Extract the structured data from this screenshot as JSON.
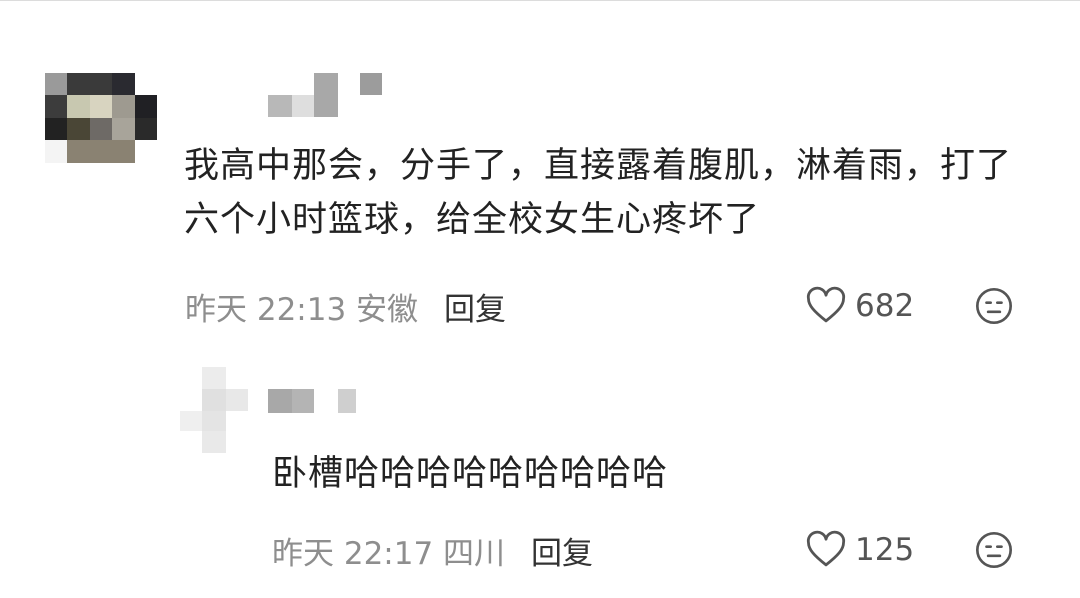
{
  "comment": {
    "text": "我高中那会，分手了，直接露着腹肌，淋着雨，打了六个小时篮球，给全校女生心疼坏了",
    "meta": "昨天 22:13 安徽",
    "reply_label": "回复",
    "like_count": "682",
    "like_icon": "heart-outline-icon",
    "dislike_icon": "face-neutral-icon"
  },
  "reply": {
    "text": "卧槽哈哈哈哈哈哈哈哈哈",
    "meta": "昨天 22:17 四川",
    "reply_label": "回复",
    "like_count": "125",
    "like_icon": "heart-outline-icon",
    "dislike_icon": "face-neutral-icon"
  },
  "colors": {
    "text": "#222222",
    "meta": "#8e8e8e",
    "icon": "#555555"
  }
}
